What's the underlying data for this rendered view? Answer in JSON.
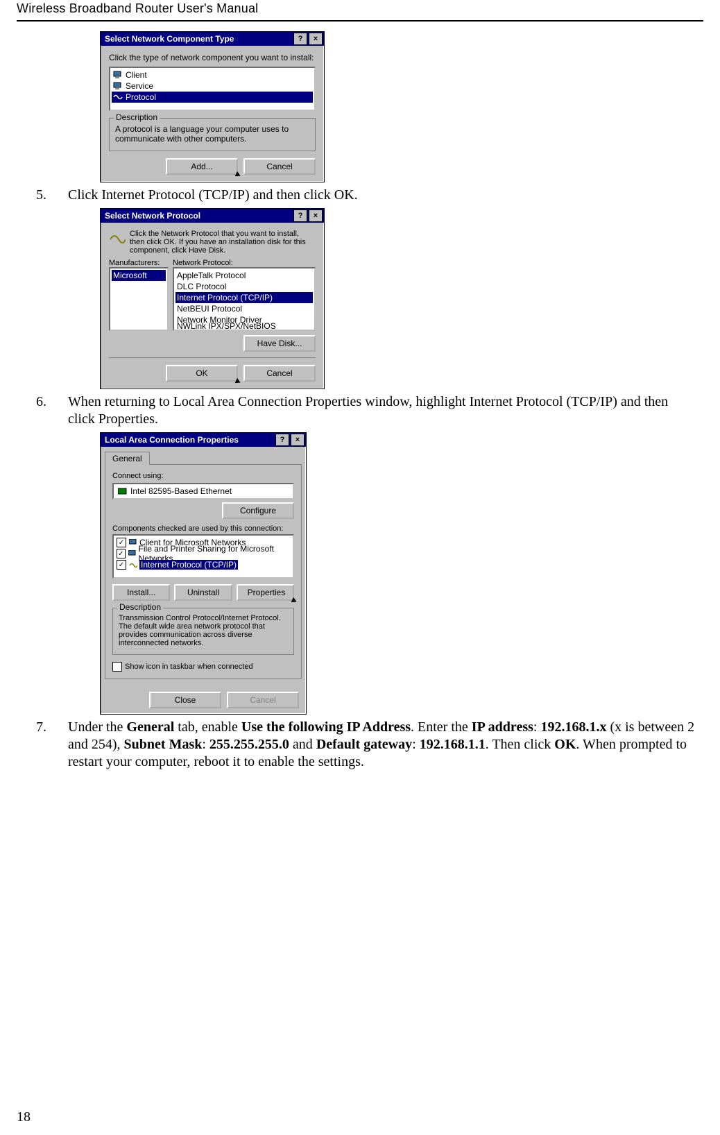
{
  "header": {
    "title": "Wireless Broadband Router User's Manual"
  },
  "page_number": "18",
  "steps": {
    "s5": {
      "num": "5.",
      "text": "Click Internet Protocol (TCP/IP) and then click OK."
    },
    "s6": {
      "num": "6.",
      "text": "When returning to Local Area Connection Properties window, highlight Internet Protocol (TCP/IP) and then click Properties."
    },
    "s7": {
      "num": "7.",
      "pre": "Under the ",
      "b1": "General",
      "m1": " tab, enable ",
      "b2": "Use the following IP Address",
      "m2": ". Enter the ",
      "b3": "IP address",
      "m3": ": ",
      "b4": "192.168.1.x",
      "m4": " (x is between 2 and 254), ",
      "b5": "Subnet Mask",
      "m5": ": ",
      "b6": "255.255.255.0",
      "m6": " and ",
      "b7": "Default gateway",
      "m7": ": ",
      "b8": "192.168.1.1",
      "m8": ". Then click ",
      "b9": "OK",
      "m9": ". When prompted to restart your computer, reboot it to enable the settings."
    }
  },
  "dlg1": {
    "title": "Select Network Component Type",
    "help": "?",
    "close": "×",
    "prompt": "Click the type of network component you want to install:",
    "items": {
      "client": "Client",
      "service": "Service",
      "protocol": "Protocol"
    },
    "desc_label": "Description",
    "desc_text": "A protocol is a language your computer uses to communicate with other computers.",
    "add": "Add...",
    "cancel": "Cancel"
  },
  "dlg2": {
    "title": "Select Network Protocol",
    "help": "?",
    "close": "×",
    "prompt": "Click the Network Protocol that you want to install, then click OK. If you have an installation disk for this component, click Have Disk.",
    "manu_label": "Manufacturers:",
    "proto_label": "Network Protocol:",
    "manu": "Microsoft",
    "protos": {
      "p1": "AppleTalk Protocol",
      "p2": "DLC Protocol",
      "p3": "Internet Protocol (TCP/IP)",
      "p4": "NetBEUI Protocol",
      "p5": "Network Monitor Driver",
      "p6": "NWLink IPX/SPX/NetBIOS Compatible Transport Pr"
    },
    "have_disk": "Have Disk...",
    "ok": "OK",
    "cancel": "Cancel"
  },
  "dlg3": {
    "title": "Local Area Connection Properties",
    "help": "?",
    "close": "×",
    "tab": "General",
    "connect_using_label": "Connect using:",
    "adapter": "Intel 82595-Based Ethernet",
    "configure": "Configure",
    "components_label": "Components checked are used by this connection:",
    "comps": {
      "c1": "Client for Microsoft Networks",
      "c2": "File and Printer Sharing for Microsoft Networks",
      "c3": "Internet Protocol (TCP/IP)"
    },
    "install": "Install...",
    "uninstall": "Uninstall",
    "properties": "Properties",
    "desc_label": "Description",
    "desc_text": "Transmission Control Protocol/Internet Protocol. The default wide area network protocol that provides communication across diverse interconnected networks.",
    "show_icon": "Show icon in taskbar when connected",
    "close_btn": "Close",
    "cancel": "Cancel"
  }
}
